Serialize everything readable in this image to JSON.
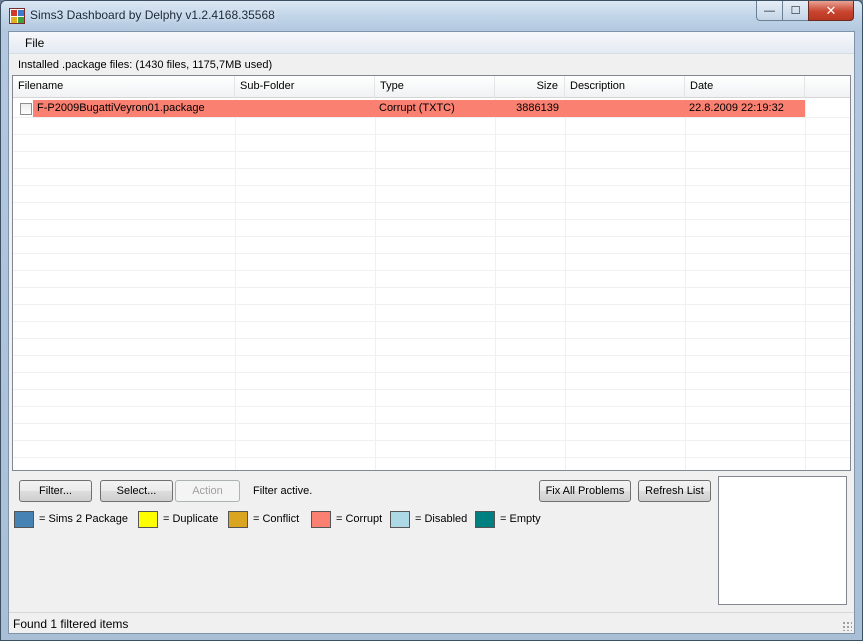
{
  "window": {
    "title": "Sims3 Dashboard by Delphy v1.2.4168.35568",
    "minimize_glyph": "—",
    "maximize_glyph": "☐",
    "close_glyph": "✕"
  },
  "menu": {
    "file_label": "File"
  },
  "files_info": "Installed .package files: (1430 files, 1175,7MB used)",
  "table": {
    "columns": [
      "Filename",
      "Sub-Folder",
      "Type",
      "Size",
      "Description",
      "Date"
    ],
    "rows": [
      {
        "checked": false,
        "filename": "F-P2009BugattiVeyron01.package",
        "subfolder": "",
        "type": "Corrupt (TXTC)",
        "size": "3886139",
        "description": "",
        "date": "22.8.2009 22:19:32",
        "highlight_color": "#fa8072"
      }
    ]
  },
  "buttons": {
    "filter": "Filter...",
    "select": "Select...",
    "action": "Action",
    "fix_all": "Fix All Problems",
    "refresh": "Refresh List"
  },
  "filter_status": "Filter active.",
  "legend": [
    {
      "label": "= Sims 2 Package",
      "color": "#4682b4"
    },
    {
      "label": "= Duplicate",
      "color": "#ffff00"
    },
    {
      "label": "= Conflict",
      "color": "#daa520"
    },
    {
      "label": "= Corrupt",
      "color": "#fa8072"
    },
    {
      "label": "= Disabled",
      "color": "#add8e6"
    },
    {
      "label": "= Empty",
      "color": "#008080"
    }
  ],
  "status": "Found 1 filtered items"
}
